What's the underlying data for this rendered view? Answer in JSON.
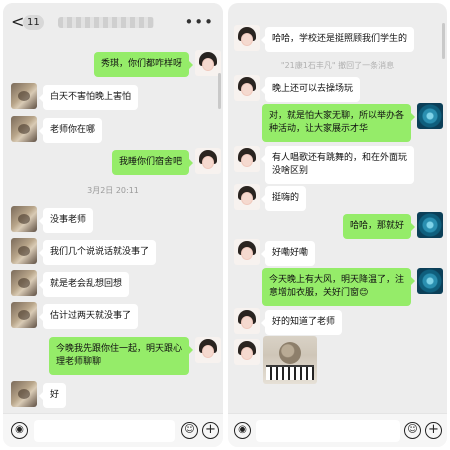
{
  "left": {
    "header": {
      "back": "<",
      "unread": "11",
      "more": "•••"
    },
    "messages": [
      {
        "side": "out",
        "text": "秀琪，你们都咋样呀"
      },
      {
        "side": "in",
        "text": "白天不害怕晚上害怕"
      },
      {
        "side": "in",
        "text": "老师你在哪"
      },
      {
        "side": "out",
        "text": "我睡你们宿舍吧"
      },
      {
        "side": "in",
        "text": "没事老师"
      },
      {
        "side": "in",
        "text": "我们几个说说话就没事了"
      },
      {
        "side": "in",
        "text": "就是老会乱想回想"
      },
      {
        "side": "in",
        "text": "估计过两天就没事了"
      },
      {
        "side": "out",
        "line1": "今晚我先跟你住一起，明天跟心",
        "line2": "理老师聊聊"
      },
      {
        "side": "in",
        "text": "好"
      }
    ],
    "timestamp": "3月2日 20:11",
    "input": {
      "voice": "◉",
      "emoji": "☺",
      "plus": "+"
    }
  },
  "right": {
    "messages": [
      {
        "side": "in",
        "text": "哈哈，学校还是挺照顾我们学生的"
      },
      {
        "side": "in",
        "text": "晚上还可以去操场玩"
      },
      {
        "side": "out",
        "line1": "对，就是怕大家无聊，所以举办各",
        "line2": "种活动，让大家展示才华"
      },
      {
        "side": "in",
        "line1": "有人唱歌还有跳舞的，和在外面玩",
        "line2": "没啥区别"
      },
      {
        "side": "in",
        "text": "挺嗨的"
      },
      {
        "side": "out",
        "text": "哈哈，那就好"
      },
      {
        "side": "in",
        "text": "好嘞好嘞"
      },
      {
        "side": "out",
        "line1": "今天晚上有大风，明天降温了，注",
        "line2": "意增加衣服，关好门窗😊"
      },
      {
        "side": "in",
        "text": "好的知道了老师"
      }
    ],
    "system_note": "\"21康1石丰凡\" 撤回了一条消息",
    "input": {
      "voice": "◉",
      "emoji": "☺",
      "plus": "+"
    }
  }
}
